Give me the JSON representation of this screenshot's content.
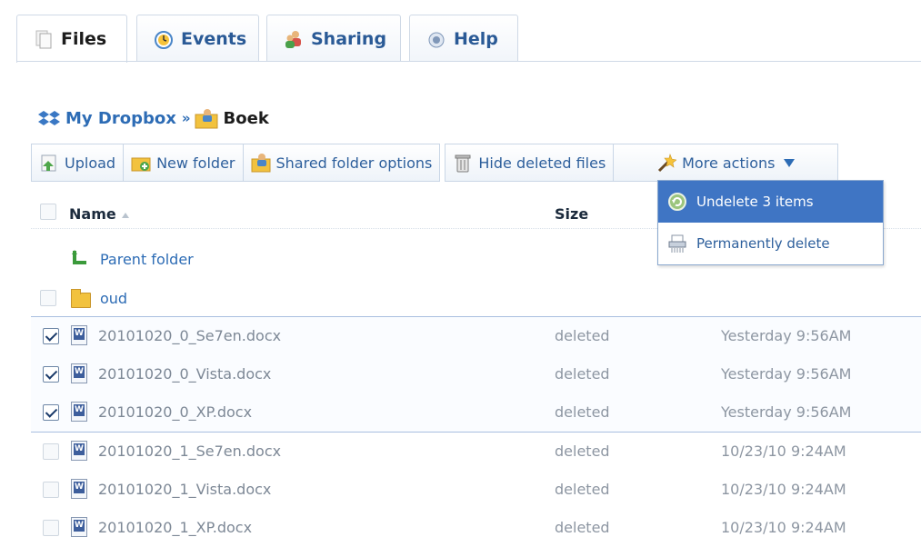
{
  "tabs": [
    {
      "label": "Files",
      "icon": "files-icon",
      "active": true
    },
    {
      "label": "Events",
      "icon": "clock-icon",
      "active": false
    },
    {
      "label": "Sharing",
      "icon": "people-icon",
      "active": false
    },
    {
      "label": "Help",
      "icon": "help-icon",
      "active": false
    }
  ],
  "breadcrumb": {
    "root": "My Dropbox",
    "separator": "»",
    "current": "Boek"
  },
  "toolbar": {
    "upload": "Upload",
    "new_folder": "New folder",
    "shared_folder_options": "Shared folder options",
    "hide_deleted": "Hide deleted files",
    "more_actions": "More actions"
  },
  "dropdown": {
    "undelete": "Undelete 3 items",
    "permanently_delete": "Permanently delete"
  },
  "table": {
    "col_name": "Name",
    "col_size": "Size",
    "parent_folder": "Parent folder",
    "folder": "oud",
    "rows": [
      {
        "name": "20101020_0_Se7en.docx",
        "size": "deleted",
        "modified": "Yesterday 9:56AM",
        "checked": true
      },
      {
        "name": "20101020_0_Vista.docx",
        "size": "deleted",
        "modified": "Yesterday 9:56AM",
        "checked": true
      },
      {
        "name": "20101020_0_XP.docx",
        "size": "deleted",
        "modified": "Yesterday 9:56AM",
        "checked": true
      },
      {
        "name": "20101020_1_Se7en.docx",
        "size": "deleted",
        "modified": "10/23/10 9:24AM",
        "checked": false
      },
      {
        "name": "20101020_1_Vista.docx",
        "size": "deleted",
        "modified": "10/23/10 9:24AM",
        "checked": false
      },
      {
        "name": "20101020_1_XP.docx",
        "size": "deleted",
        "modified": "10/23/10 9:24AM",
        "checked": false
      }
    ]
  },
  "colors": {
    "accent": "#2d6cb5",
    "highlight": "#3f75c4"
  }
}
